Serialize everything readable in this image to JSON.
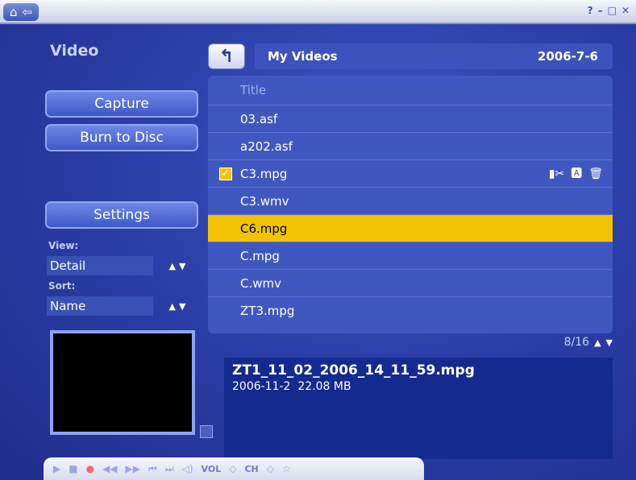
{
  "topbar": {
    "home_icon": "home-icon",
    "back_icon": "back-arrow-icon",
    "window_controls": [
      "?",
      "–",
      "□",
      "✕"
    ]
  },
  "section_title": "Video",
  "buttons": {
    "capture": "Capture",
    "burn": "Burn to Disc",
    "settings": "Settings"
  },
  "view": {
    "label": "View:",
    "value": "Detail"
  },
  "sort": {
    "label": "Sort:",
    "value": "Name"
  },
  "path": {
    "name": "My Videos",
    "date": "2006-7-6"
  },
  "list": {
    "header": "Title",
    "rows": [
      {
        "name": "03.asf",
        "checked": false,
        "selected": false
      },
      {
        "name": "a202.asf",
        "checked": false,
        "selected": false
      },
      {
        "name": "C3.mpg",
        "checked": true,
        "selected": false
      },
      {
        "name": "C3.wmv",
        "checked": false,
        "selected": false
      },
      {
        "name": "C6.mpg",
        "checked": false,
        "selected": true
      },
      {
        "name": "C.mpg",
        "checked": false,
        "selected": false
      },
      {
        "name": "C.wmv",
        "checked": false,
        "selected": false
      },
      {
        "name": "ZT3.mpg",
        "checked": false,
        "selected": false
      }
    ]
  },
  "pager": {
    "text": "8/16"
  },
  "info": {
    "filename": "ZT1_11_02_2006_14_11_59.mpg",
    "date": "2006-11-2",
    "size": "22.08 MB"
  },
  "controls": {
    "vol_label": "VOL",
    "ch_label": "CH"
  },
  "colors": {
    "accent": "#f2c300",
    "panel": "#4157c0",
    "background": "#2c3fa8"
  }
}
